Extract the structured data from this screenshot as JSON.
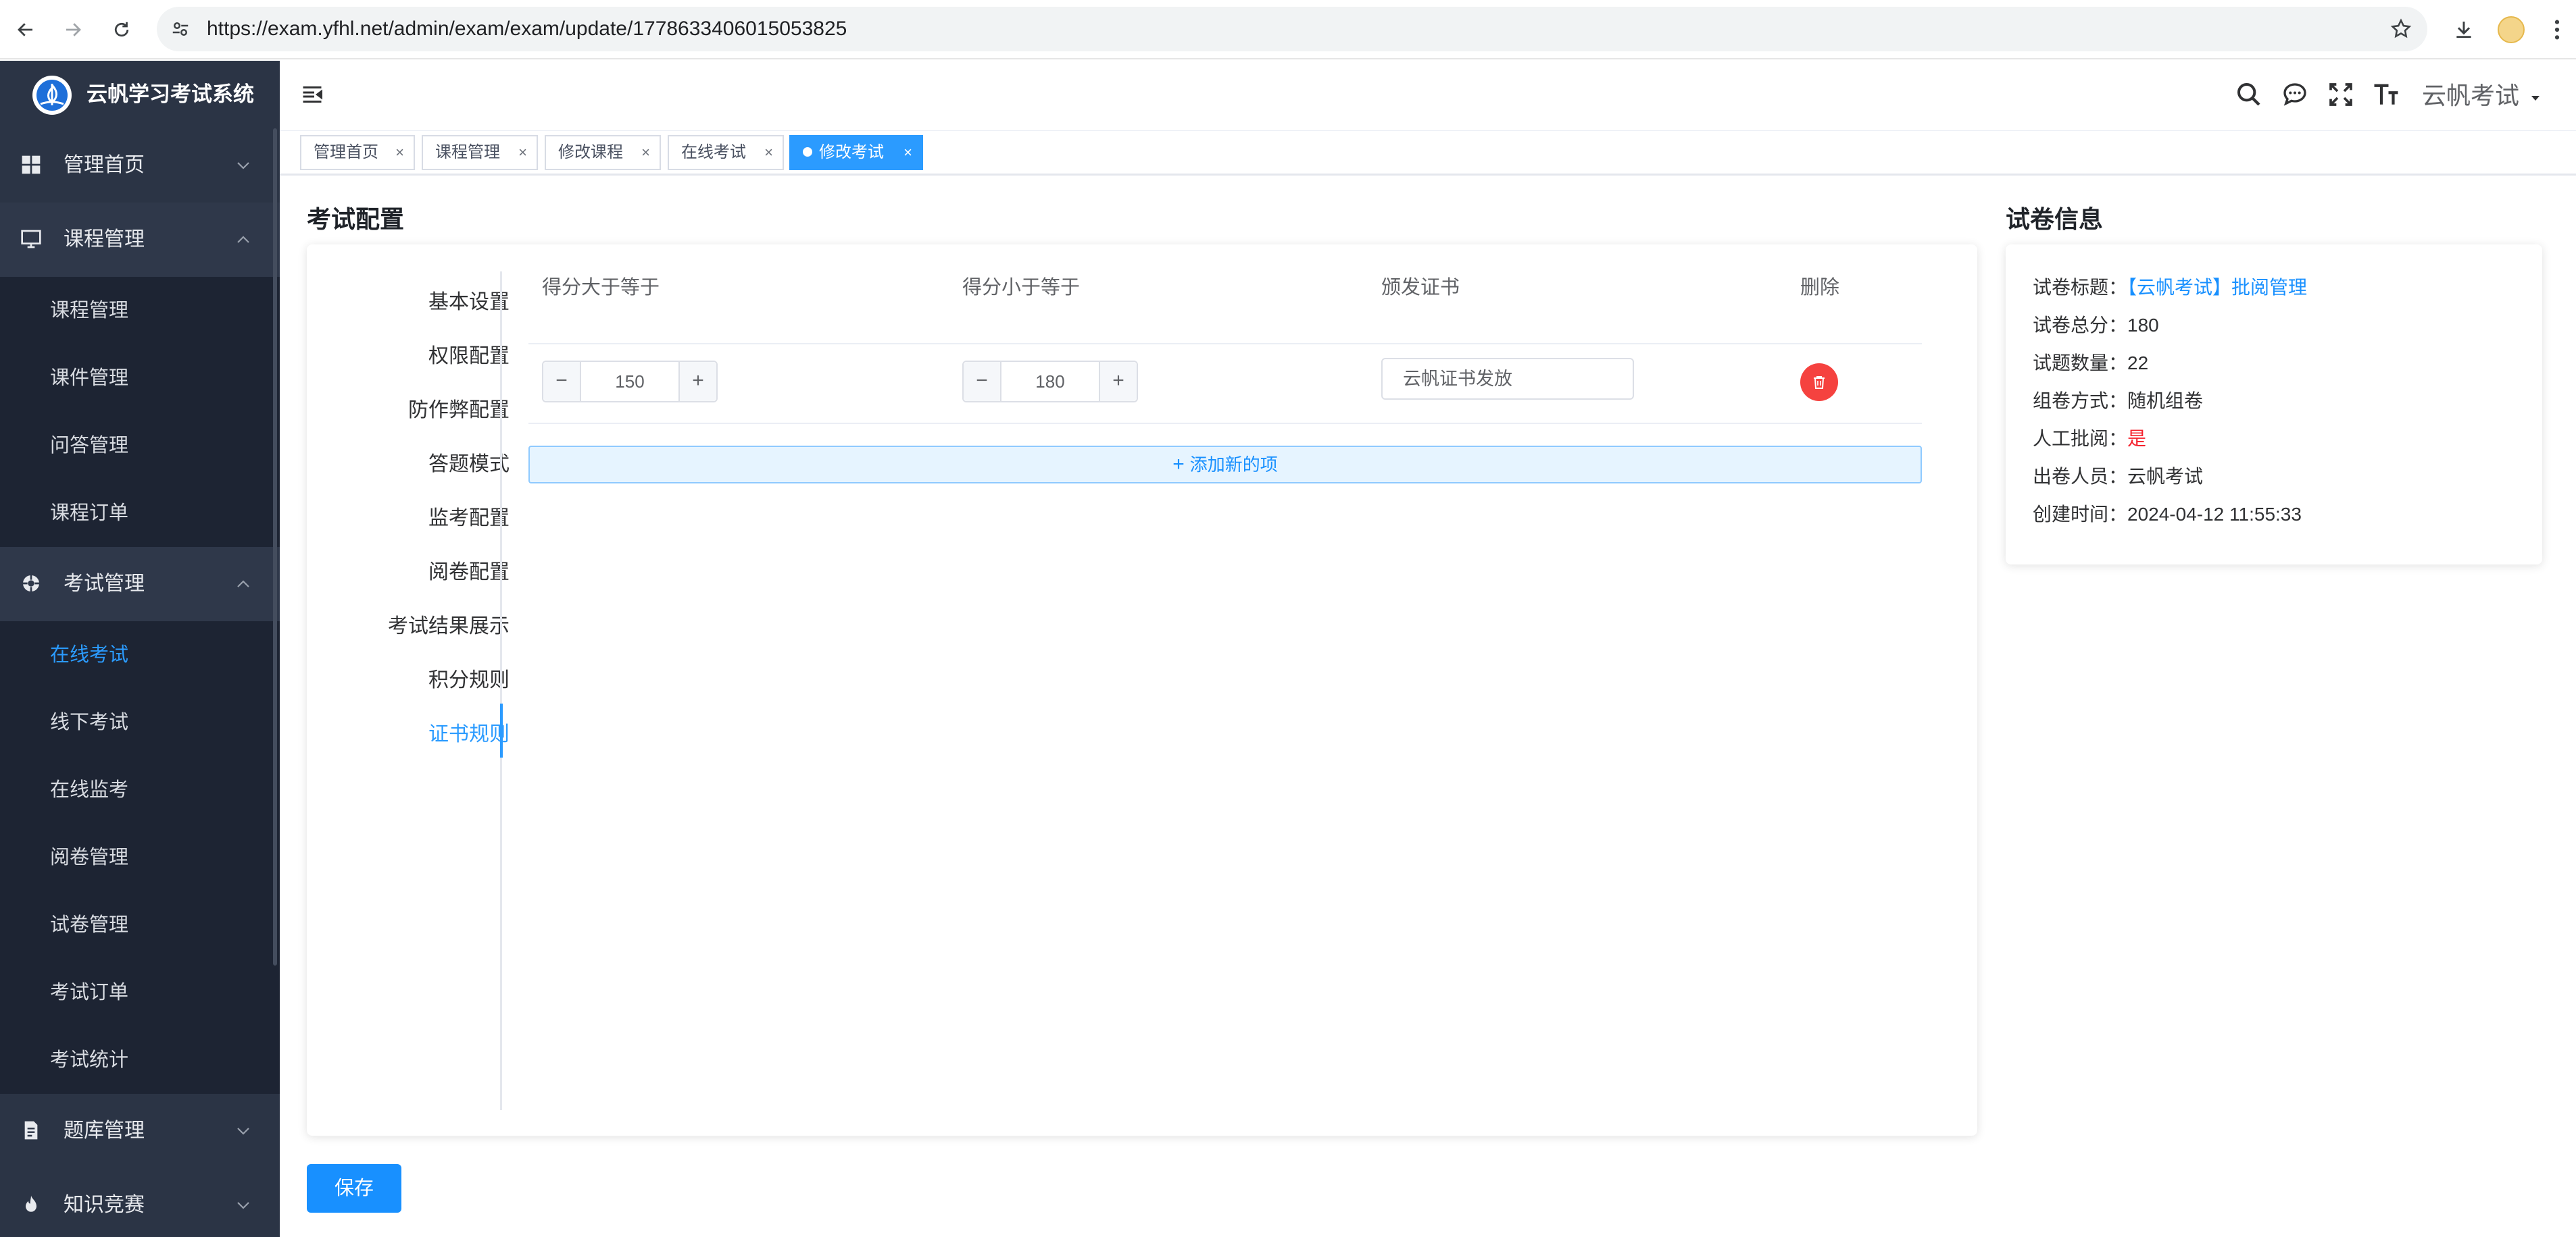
{
  "browser": {
    "url": "https://exam.yfhl.net/admin/exam/exam/update/1778633406015053825"
  },
  "app": {
    "title": "云帆学习考试系统",
    "user": "云帆考试"
  },
  "sidebar": {
    "menus": [
      {
        "label": "管理首页",
        "icon": "dashboard-icon",
        "expanded": false
      },
      {
        "label": "课程管理",
        "icon": "monitor-icon",
        "expanded": true,
        "children": [
          "课程管理",
          "课件管理",
          "问答管理",
          "课程订单"
        ]
      },
      {
        "label": "考试管理",
        "icon": "exam-icon",
        "expanded": true,
        "children": [
          "在线考试",
          "线下考试",
          "在线监考",
          "阅卷管理",
          "试卷管理",
          "考试订单",
          "考试统计"
        ]
      },
      {
        "label": "题库管理",
        "icon": "document-icon",
        "expanded": false
      },
      {
        "label": "知识竞赛",
        "icon": "fire-icon",
        "expanded": false
      }
    ],
    "active_item": "在线考试"
  },
  "tags": [
    {
      "label": "管理首页",
      "active": false
    },
    {
      "label": "课程管理",
      "active": false
    },
    {
      "label": "修改课程",
      "active": false
    },
    {
      "label": "在线考试",
      "active": false
    },
    {
      "label": "修改考试",
      "active": true
    }
  ],
  "config": {
    "title": "考试配置",
    "nav": [
      "基本设置",
      "权限配置",
      "防作弊配置",
      "答题模式",
      "监考配置",
      "阅卷配置",
      "考试结果展示",
      "积分规则",
      "证书规则"
    ],
    "active_nav": "证书规则",
    "table": {
      "headers": [
        "得分大于等于",
        "得分小于等于",
        "颁发证书",
        "删除"
      ],
      "rows": [
        {
          "min": "150",
          "max": "180",
          "certificate": "云帆证书发放"
        }
      ]
    },
    "add_label": "添加新的项",
    "save_label": "保存"
  },
  "paper": {
    "title": "试卷信息",
    "rows": [
      {
        "label": "试卷标题：",
        "value": "【云帆考试】批阅管理",
        "color": "#1890ff"
      },
      {
        "label": "试卷总分：",
        "value": "180"
      },
      {
        "label": "试题数量：",
        "value": "22"
      },
      {
        "label": "组卷方式：",
        "value": "随机组卷"
      },
      {
        "label": "人工批阅：",
        "value": "是",
        "color": "#f5222d"
      },
      {
        "label": "出卷人员：",
        "value": "云帆考试"
      },
      {
        "label": "创建时间：",
        "value": "2024-04-12 11:55:33"
      }
    ]
  },
  "colors": {
    "accent": "#2b9bff",
    "sidebar_bg": "#2b3445",
    "sidebar_sub_bg": "#1d2433",
    "danger": "#f5423f"
  }
}
